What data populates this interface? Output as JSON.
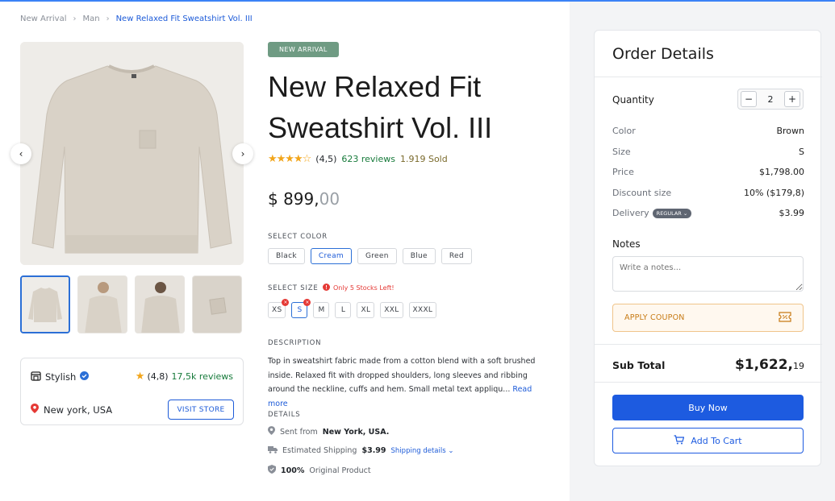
{
  "breadcrumb": {
    "items": [
      "New Arrival",
      "Man"
    ],
    "current": "New Relaxed Fit Sweatshirt Vol. III"
  },
  "product": {
    "badge": "NEW ARRIVAL",
    "title_line1": "New Relaxed Fit",
    "title_line2": "Sweatshirt Vol. III",
    "rating": "(4,5)",
    "rating_value": 4.5,
    "reviews": "623 reviews",
    "sold": "1.919 Sold",
    "price_main": "$ 899,",
    "price_decimal": "00",
    "select_color_label": "SELECT COLOR",
    "colors": [
      "Black",
      "Cream",
      "Green",
      "Blue",
      "Red"
    ],
    "selected_color": "Cream",
    "select_size_label": "SELECT SIZE",
    "stock_warning": "Only 5 Stocks Left!",
    "sizes": [
      "XS",
      "S",
      "M",
      "L",
      "XL",
      "XXL",
      "XXXL"
    ],
    "selected_size": "S",
    "description_label": "DESCRIPTION",
    "description_l1": "Top in sweatshirt fabric made from a cotton blend with a soft brushed",
    "description_l2": "inside. Relaxed fit with dropped shoulders, long sleeves and ribbing",
    "description_l3": "around the neckline, cuffs and hem. Small metal text appliqu...",
    "read_more": "Read more",
    "details_label": "DETAILS",
    "sent_from_prefix": "Sent from",
    "sent_from": "New York, USA.",
    "shipping_prefix": "Estimated Shipping",
    "shipping_price": "$3.99",
    "shipping_link": "Shipping details",
    "original_pct": "100%",
    "original_text": "Original Product"
  },
  "store": {
    "name": "Stylish",
    "rating": "(4,8)",
    "reviews": "17,5k reviews",
    "location": "New york, USA",
    "visit_label": "VISIT STORE"
  },
  "order": {
    "title": "Order Details",
    "quantity_label": "Quantity",
    "quantity": "2",
    "rows": [
      {
        "k": "Color",
        "v": "Brown"
      },
      {
        "k": "Size",
        "v": "S"
      },
      {
        "k": "Price",
        "v": "$1,798.00"
      },
      {
        "k": "Discount size",
        "v": "10% ($179,8)"
      },
      {
        "k": "Delivery",
        "v": "$3.99"
      }
    ],
    "delivery_badge": "REGULAR",
    "notes_label": "Notes",
    "notes_placeholder": "Write a notes...",
    "coupon_label": "APPLY COUPON",
    "subtotal_label": "Sub Total",
    "subtotal_main": "$1,622,",
    "subtotal_decimal": "19",
    "buy_label": "Buy Now",
    "cart_label": "Add To Cart"
  },
  "colors": {
    "accent": "#1d5be0",
    "badge_green": "#6f9b83",
    "star": "#f2a51a",
    "warning": "#e53935"
  }
}
